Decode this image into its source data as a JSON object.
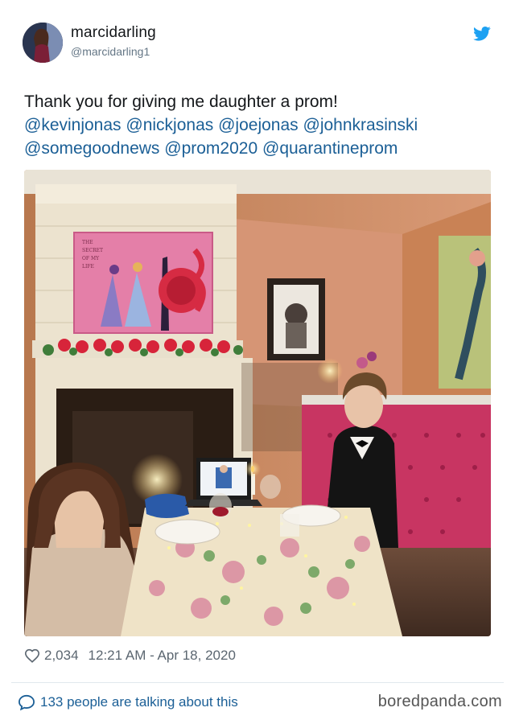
{
  "user": {
    "display_name": "marcidarling",
    "handle": "@marcidarling1"
  },
  "tweet": {
    "text": "Thank you for giving me daughter a prom!",
    "mentions_line1": [
      "@kevinjonas",
      "@nickjonas",
      "@joejonas",
      "@johnkrasinski"
    ],
    "mentions_line2": [
      "@somegoodnews",
      "@prom2020",
      "@quarantineprom"
    ]
  },
  "stats": {
    "likes": "2,034",
    "timestamp": "12:21 AM - Apr 18, 2020"
  },
  "footer": {
    "talking": "133 people are talking about this",
    "brand": "boredpanda.com"
  },
  "photo": {
    "painting_text": "THE SECRET OF MY LIFE"
  },
  "icons": {
    "bird": "twitter-bird-icon",
    "heart": "heart-icon",
    "bubble": "comment-bubble-icon"
  },
  "colors": {
    "link": "#1b5f96",
    "twitter_blue": "#1da1f2",
    "muted": "#657786"
  }
}
